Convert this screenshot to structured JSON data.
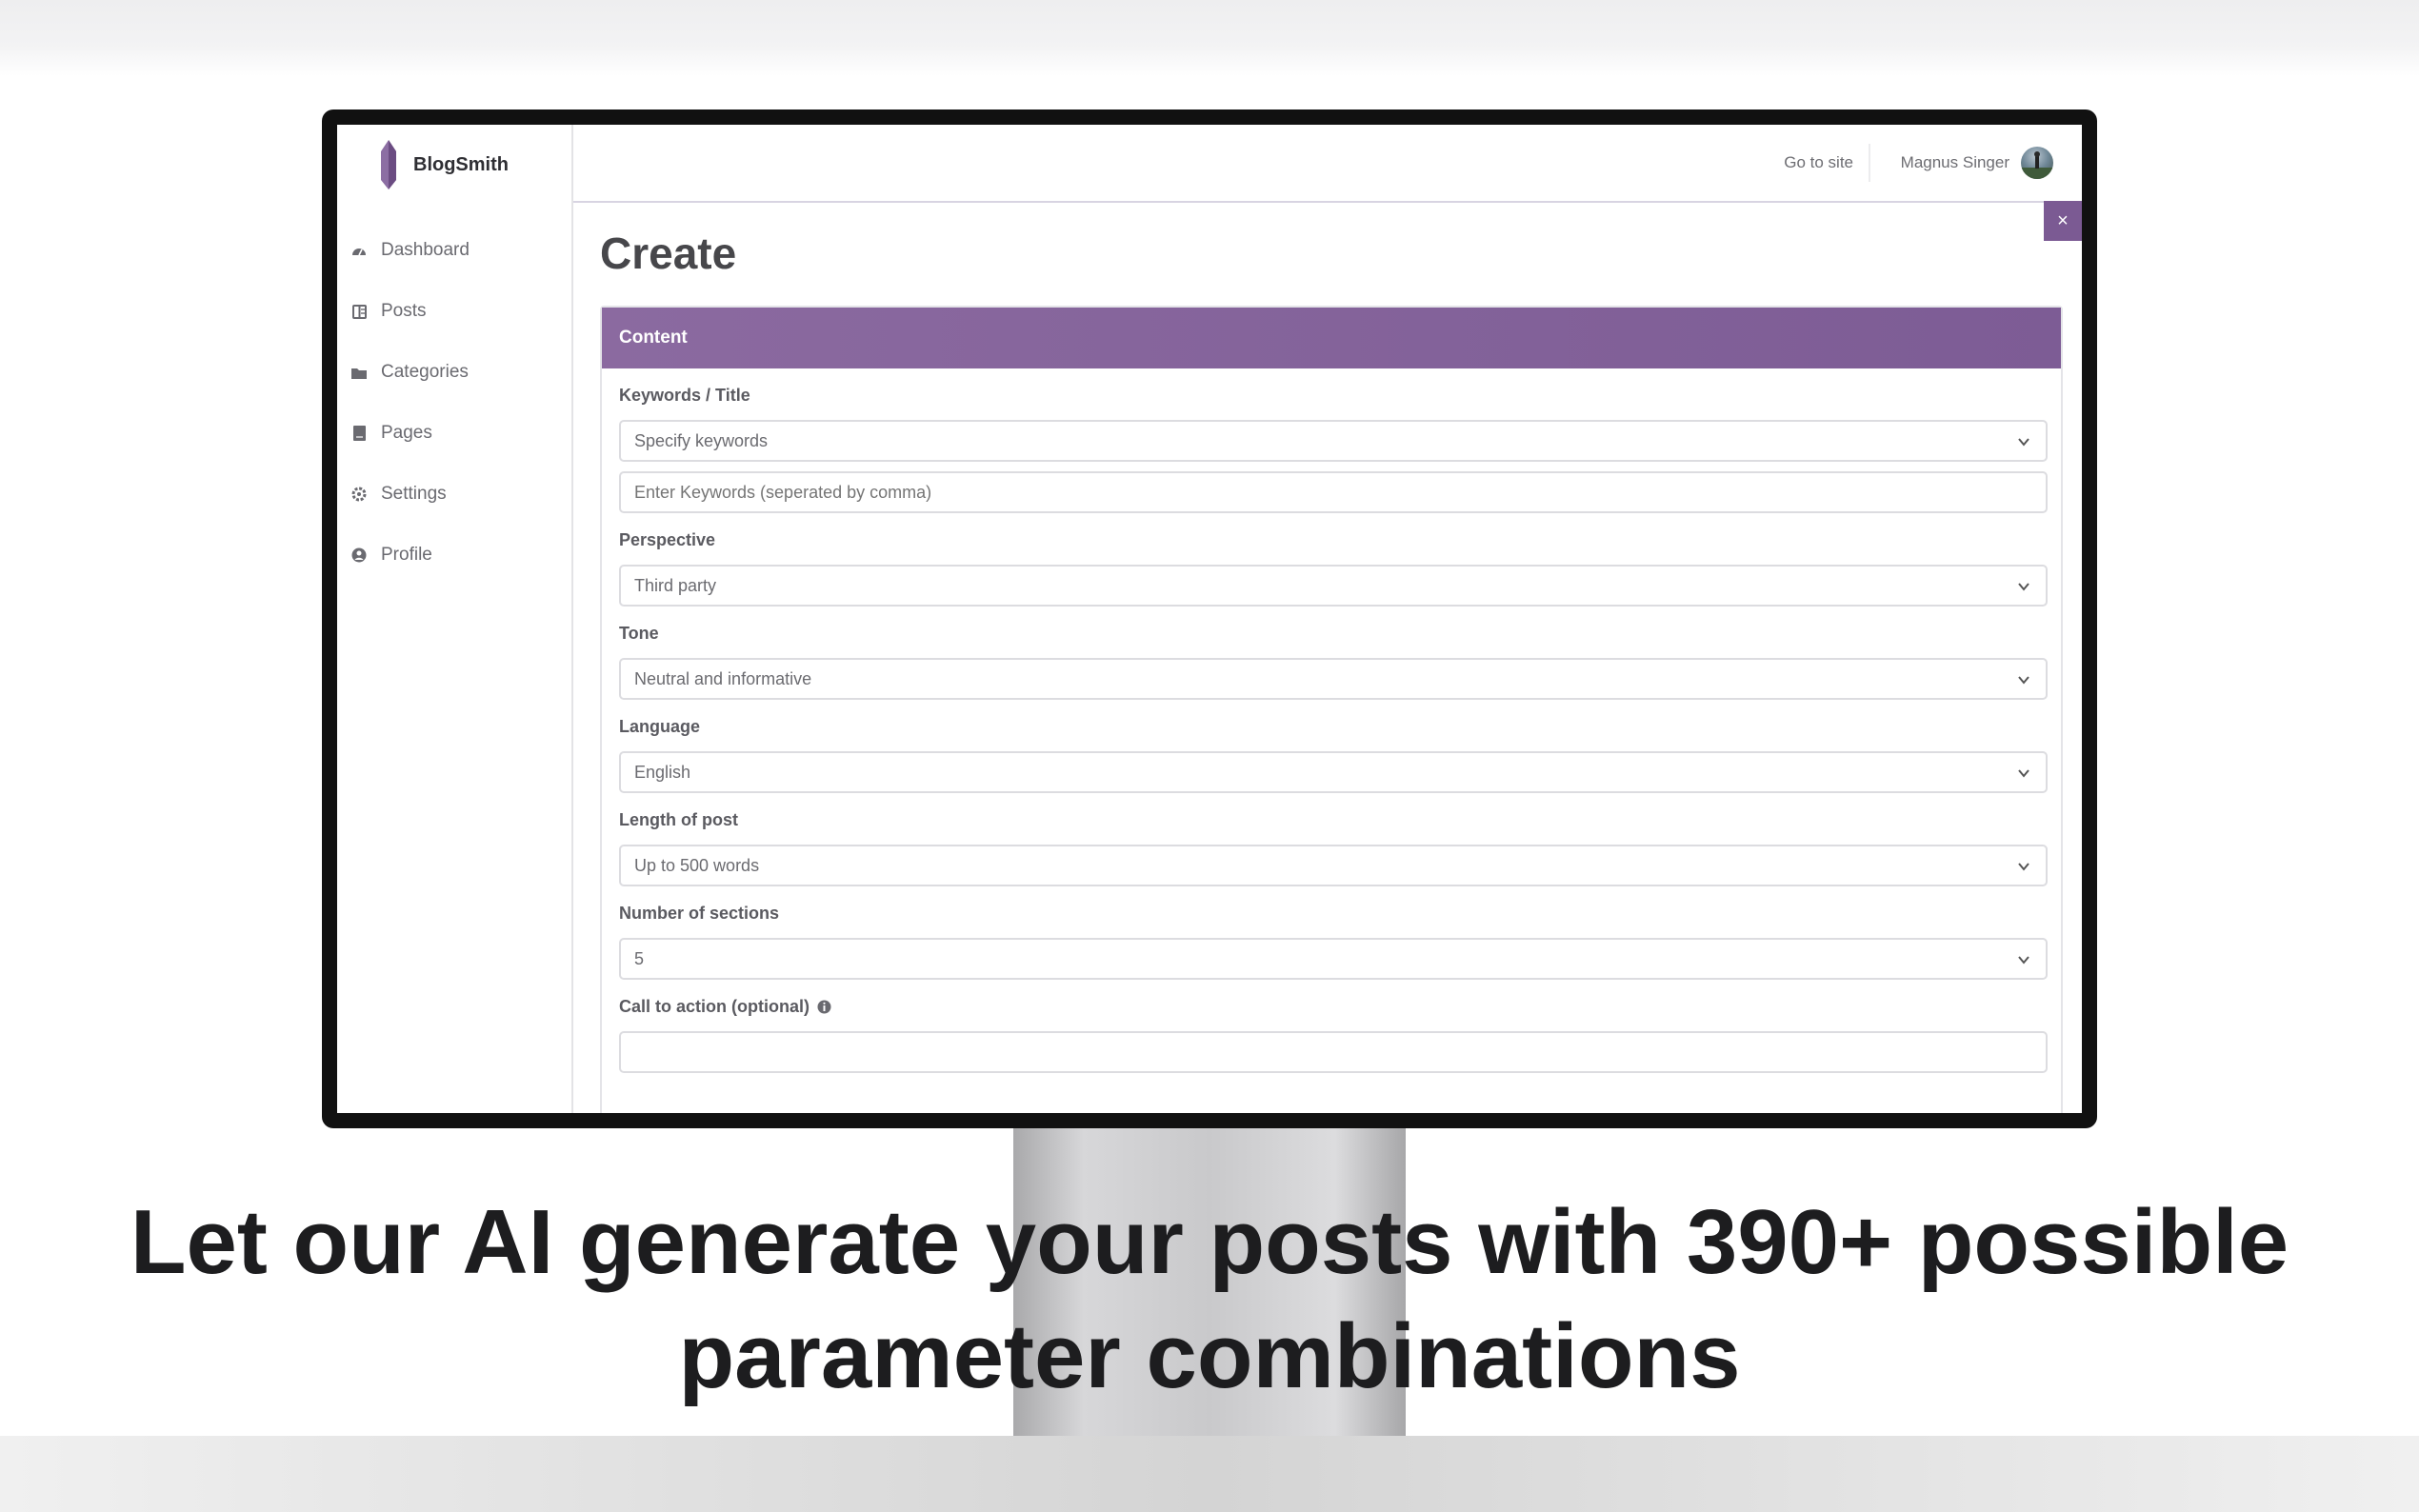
{
  "app": {
    "brand": "BlogSmith",
    "colors": {
      "accent": "#7d5c95",
      "sidebar_text": "#6a6a70"
    }
  },
  "sidebar": {
    "items": [
      {
        "label": "Dashboard",
        "icon": "dashboard-icon"
      },
      {
        "label": "Posts",
        "icon": "posts-icon"
      },
      {
        "label": "Categories",
        "icon": "folder-icon"
      },
      {
        "label": "Pages",
        "icon": "page-icon"
      },
      {
        "label": "Settings",
        "icon": "gear-icon"
      },
      {
        "label": "Profile",
        "icon": "user-circle-icon"
      }
    ]
  },
  "topbar": {
    "go_to_site": "Go to site",
    "user_name": "Magnus Singer",
    "close_label": "×"
  },
  "main": {
    "title": "Create",
    "card_title": "Content",
    "fields": {
      "keywords": {
        "label": "Keywords / Title",
        "select_value": "Specify keywords",
        "input_placeholder": "Enter Keywords (seperated by comma)"
      },
      "perspective": {
        "label": "Perspective",
        "value": "Third party"
      },
      "tone": {
        "label": "Tone",
        "value": "Neutral and informative"
      },
      "language": {
        "label": "Language",
        "value": "English"
      },
      "length": {
        "label": "Length of post",
        "value": "Up to 500 words"
      },
      "sections": {
        "label": "Number of sections",
        "value": "5"
      },
      "cta": {
        "label": "Call to action (optional)",
        "value": ""
      }
    }
  },
  "marketing": {
    "headline_line1": "Let our AI generate your posts with 390+ possible",
    "headline_line2": "parameter combinations"
  }
}
